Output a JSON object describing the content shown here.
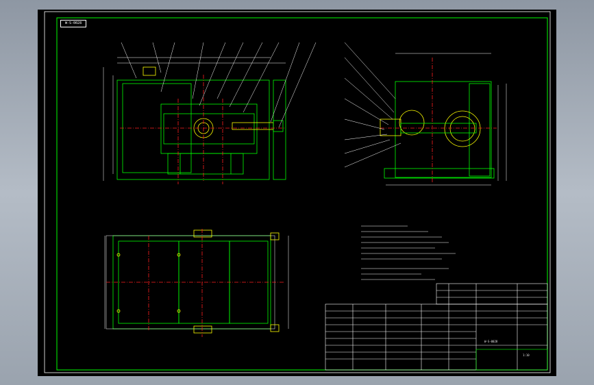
{
  "sheet_title": "W-S-0028",
  "colors": {
    "background_outer": "#a3acb7",
    "sheet": "#000000",
    "frame": "#00ff00",
    "outline": "#ffffff",
    "centerline": "#ff2020",
    "dimension": "#ffffff",
    "leader": "#ffffff",
    "notes": "#ffffff",
    "table_text": "#ffff60"
  },
  "views": [
    {
      "name": "front-view"
    },
    {
      "name": "side-view"
    },
    {
      "name": "top-view"
    }
  ],
  "title_block": {
    "drawing_no": "W-S-0028",
    "scale": "1:10"
  }
}
